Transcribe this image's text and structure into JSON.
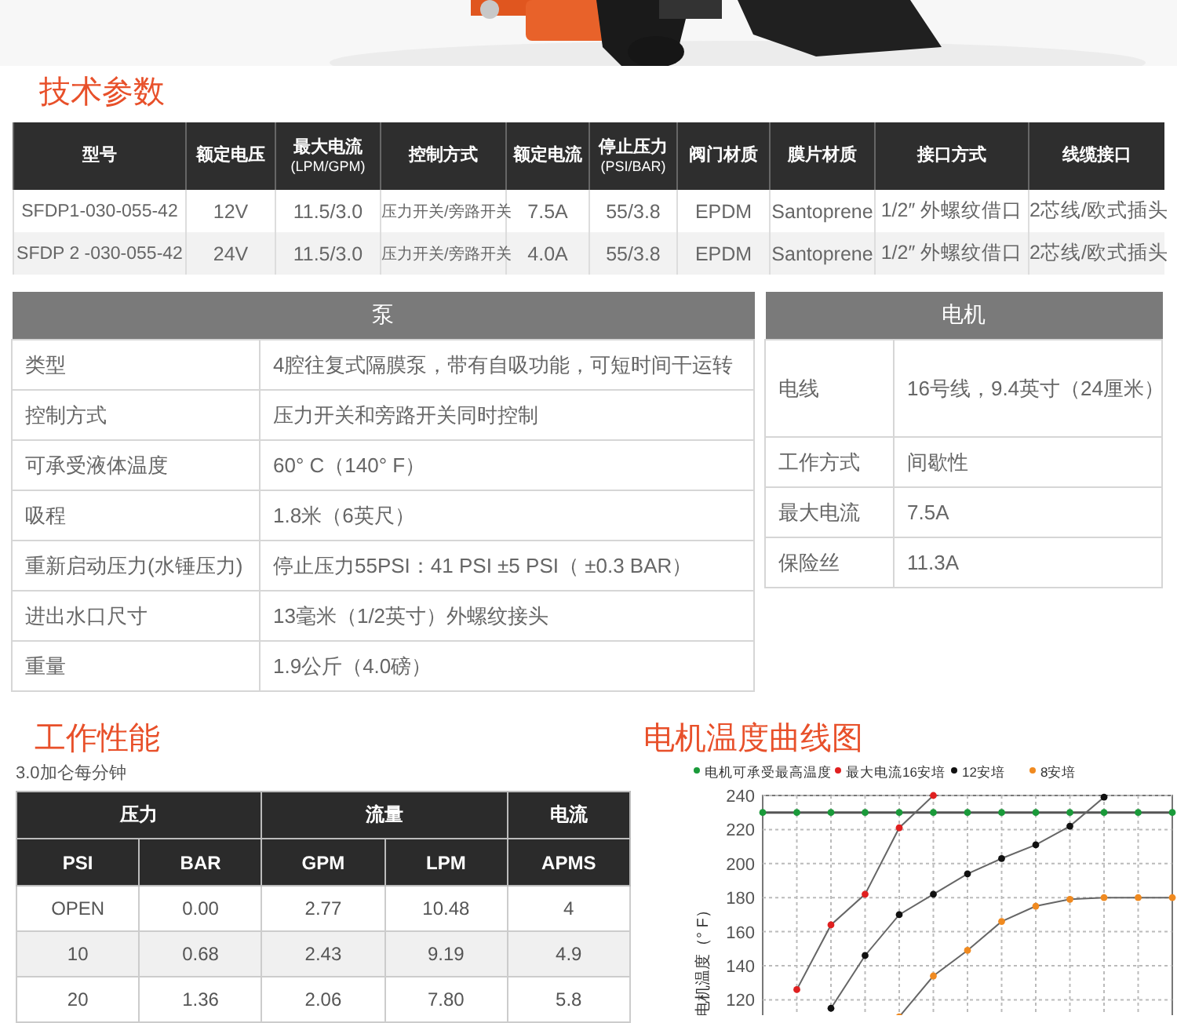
{
  "spec_section": {
    "title": "技术参数",
    "columns": [
      {
        "label": "型号"
      },
      {
        "label": "额定电压"
      },
      {
        "label": "最大电流",
        "unit": "(LPM/GPM)"
      },
      {
        "label": "控制方式"
      },
      {
        "label": "额定电流"
      },
      {
        "label": "停止压力",
        "unit": "(PSI/BAR)"
      },
      {
        "label": "阀门材质"
      },
      {
        "label": "膜片材质"
      },
      {
        "label": "接口方式"
      },
      {
        "label": "线缆接口"
      }
    ],
    "rows": [
      [
        "SFDP1-030-055-42",
        "12V",
        "11.5/3.0",
        "压力开关/旁路开关",
        "7.5A",
        "55/3.8",
        "EPDM",
        "Santoprene",
        "1/2″ 外螺纹借口",
        "2芯线/欧式插头"
      ],
      [
        "SFDP 2 -030-055-42",
        "24V",
        "11.5/3.0",
        "压力开关/旁路开关",
        "4.0A",
        "55/3.8",
        "EPDM",
        "Santoprene",
        "1/2″ 外螺纹借口",
        "2芯线/欧式插头"
      ]
    ]
  },
  "pump": {
    "title": "泵",
    "rows": [
      {
        "label": "类型",
        "value": "4腔往复式隔膜泵，带有自吸功能，可短时间干运转"
      },
      {
        "label": "控制方式",
        "value": "压力开关和旁路开关同时控制"
      },
      {
        "label": "可承受液体温度",
        "value": "60°  C（140°  F）"
      },
      {
        "label": "吸程",
        "value": "1.8米（6英尺）"
      },
      {
        "label": "重新启动压力(水锤压力)",
        "value": "停止压力55PSI：41 PSI ±5 PSI（ ±0.3 BAR）"
      },
      {
        "label": "进出水口尺寸",
        "value": "13毫米（1/2英寸）外螺纹接头"
      },
      {
        "label": "重量",
        "value": "1.9公斤（4.0磅）"
      }
    ]
  },
  "motor": {
    "title": "电机",
    "rows": [
      {
        "label": "电线",
        "value": "16号线，9.4英寸（24厘米）"
      },
      {
        "label": "工作方式",
        "value": "间歇性"
      },
      {
        "label": "最大电流",
        "value": "7.5A"
      },
      {
        "label": "保险丝",
        "value": "11.3A"
      }
    ]
  },
  "performance": {
    "title": "工作性能",
    "subtitle": "3.0加仑每分钟",
    "groups": [
      {
        "label": "压力",
        "columns": [
          "PSI",
          "BAR"
        ]
      },
      {
        "label": "流量",
        "columns": [
          "GPM",
          "LPM"
        ]
      },
      {
        "label": "电流",
        "columns": [
          "APMS"
        ]
      }
    ],
    "rows": [
      [
        "OPEN",
        "0.00",
        "2.77",
        "10.48",
        "4"
      ],
      [
        "10",
        "0.68",
        "2.43",
        "9.19",
        "4.9"
      ],
      [
        "20",
        "1.36",
        "2.06",
        "7.80",
        "5.8"
      ]
    ]
  },
  "temperature_chart": {
    "title": "电机温度曲线图",
    "chart_data": {
      "type": "line",
      "ylabel": "电机温度（° F）",
      "grid": true,
      "legend": "top",
      "ylim": [
        110,
        240
      ],
      "yticks": [
        120,
        140,
        160,
        180,
        200,
        220,
        240
      ],
      "series": [
        {
          "name": "电机可承受最高温度",
          "color": "#1a9a3a",
          "marker": "circle",
          "values": [
            230,
            230,
            230,
            230,
            230,
            230,
            230,
            230,
            230,
            230,
            230,
            230,
            230
          ]
        },
        {
          "name": "最大电流16安培",
          "color": "#e02020",
          "marker": "circle",
          "values": [
            null,
            126,
            164,
            182,
            221,
            240,
            null,
            null,
            null,
            null,
            null,
            null,
            null
          ]
        },
        {
          "name": "12安培",
          "color": "#111111",
          "marker": "circle",
          "values": [
            null,
            null,
            115,
            146,
            170,
            182,
            194,
            203,
            211,
            222,
            239,
            null,
            null
          ]
        },
        {
          "name": "8安培",
          "color": "#f08a20",
          "marker": "circle",
          "values": [
            null,
            null,
            null,
            null,
            110,
            134,
            149,
            166,
            175,
            179,
            180,
            180,
            180
          ]
        }
      ]
    }
  }
}
